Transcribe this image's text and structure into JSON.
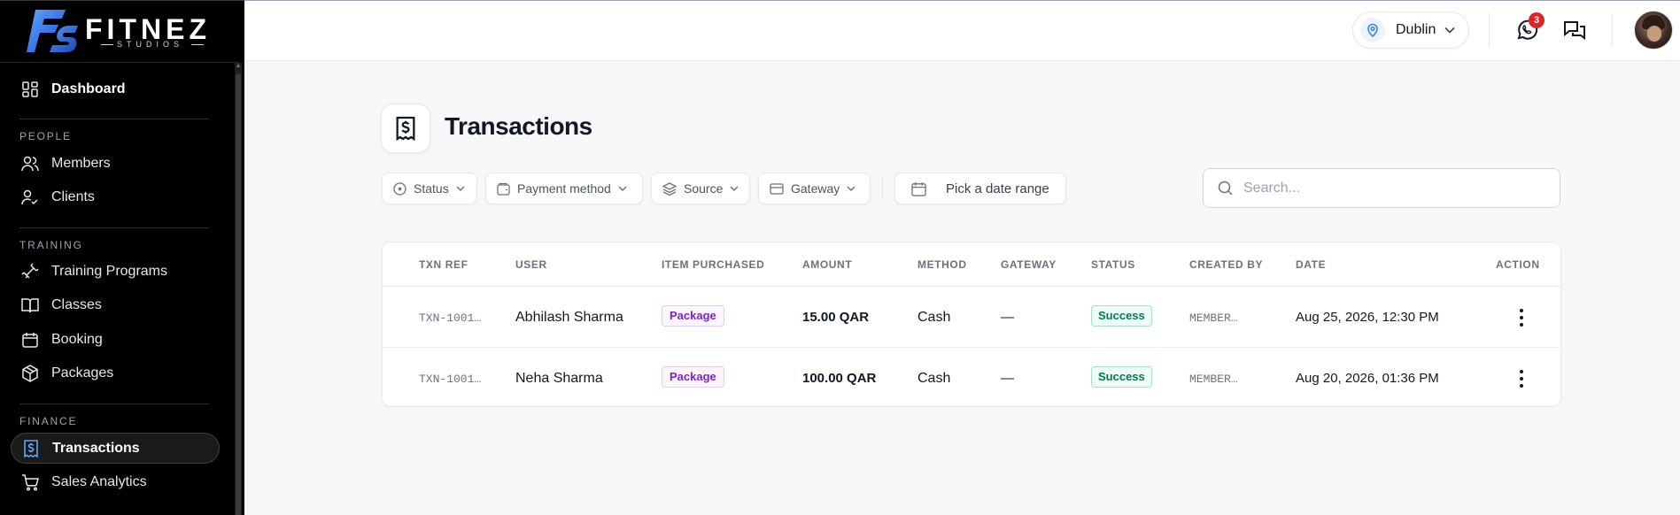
{
  "brand": {
    "name": "FITNEZ",
    "tagline": "STUDIOS",
    "logo_mark": "FS"
  },
  "sidebar": {
    "dashboard": "Dashboard",
    "sections": {
      "people": "PEOPLE",
      "training": "TRAINING",
      "finance": "FINANCE"
    },
    "items": {
      "members": "Members",
      "clients": "Clients",
      "training_programs": "Training Programs",
      "classes": "Classes",
      "booking": "Booking",
      "packages": "Packages",
      "transactions": "Transactions",
      "sales_analytics": "Sales Analytics"
    },
    "active": "Transactions"
  },
  "topbar": {
    "location": "Dublin",
    "whatsapp_badge": "3"
  },
  "page": {
    "title": "Transactions"
  },
  "filters": {
    "status": "Status",
    "payment_method": "Payment method",
    "source": "Source",
    "gateway": "Gateway",
    "date_range": "Pick a date range",
    "search_placeholder": "Search..."
  },
  "table": {
    "columns": [
      "TXN REF",
      "USER",
      "ITEM PURCHASED",
      "AMOUNT",
      "METHOD",
      "GATEWAY",
      "STATUS",
      "CREATED BY",
      "DATE",
      "ACTION"
    ],
    "rows": [
      {
        "txn_ref": "TXN-1001…",
        "user": "Abhilash Sharma",
        "item": "Package",
        "amount": "15.00 QAR",
        "method": "Cash",
        "gateway": "—",
        "status": "Success",
        "created_by": "MEMBER…",
        "date": "Aug 25, 2026, 12:30 PM"
      },
      {
        "txn_ref": "TXN-1001…",
        "user": "Neha Sharma",
        "item": "Package",
        "amount": "100.00 QAR",
        "method": "Cash",
        "gateway": "—",
        "status": "Success",
        "created_by": "MEMBER…",
        "date": "Aug 20, 2026, 01:36 PM"
      }
    ]
  },
  "colors": {
    "accent": "#3b82f6",
    "sidebar_bg": "#000000",
    "success": "#047857",
    "package": "#7e22ce",
    "badge": "#dc2626"
  }
}
